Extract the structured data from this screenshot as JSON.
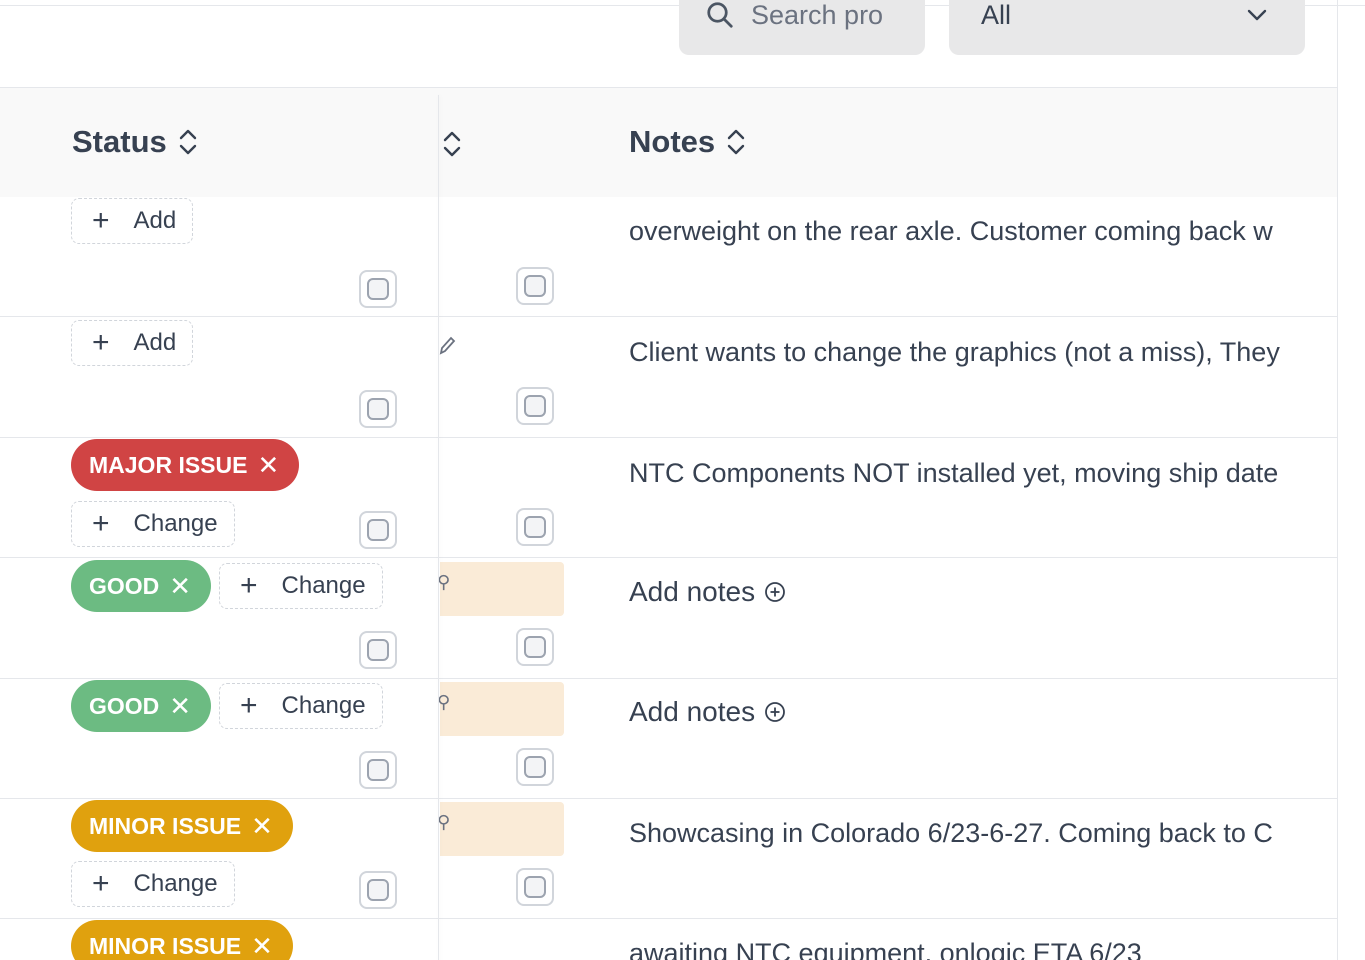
{
  "toolbar": {
    "search_placeholder": "Search pro",
    "filter_value": "All"
  },
  "table": {
    "headers": {
      "status": "Status",
      "notes": "Notes"
    },
    "add_label": "Add",
    "change_label": "Change",
    "add_notes_label": "Add notes",
    "rows": [
      {
        "status": "",
        "action": "Add",
        "note": "overweight on the rear axle. Customer coming back w"
      },
      {
        "status": "",
        "action": "Add",
        "note": "Client wants to change the graphics (not a miss), They"
      },
      {
        "status": "MAJOR ISSUE",
        "action": "Change",
        "note": "NTC Components NOT installed yet, moving ship date"
      },
      {
        "status": "GOOD",
        "action": "Change",
        "note": "Add notes"
      },
      {
        "status": "GOOD",
        "action": "Change",
        "note": "Add notes"
      },
      {
        "status": "MINOR ISSUE",
        "action": "Change",
        "note": "Showcasing in Colorado 6/23-6-27. Coming back to C"
      },
      {
        "status": "MINOR ISSUE",
        "action": "Change",
        "note": "awaiting NTC equipment, onlogic ETA 6/23"
      }
    ]
  },
  "colors": {
    "major_issue": "#d04444",
    "good": "#6cbb82",
    "minor_issue": "#e0a10e",
    "highlight": "#faebd7"
  },
  "icons": {
    "search": "search-icon",
    "chevron": "chevron-down-icon",
    "sort": "sort-icon",
    "close": "close-icon",
    "plus": "plus-icon",
    "add_circle": "plus-circle-icon",
    "pin": "pin-icon"
  }
}
